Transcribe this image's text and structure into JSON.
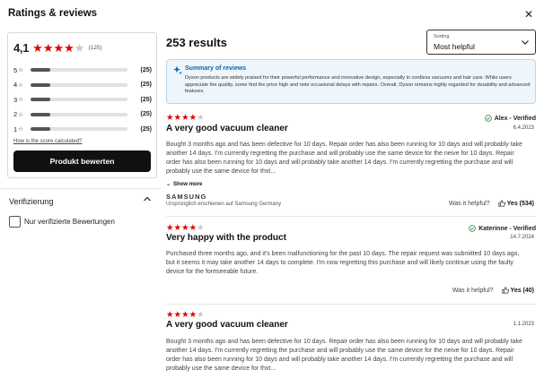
{
  "header": {
    "title": "Ratings & reviews",
    "close_icon": "close-icon"
  },
  "score": {
    "value": "4,1",
    "stars": 4,
    "count_label": "(125)",
    "distribution": [
      {
        "stars": "5",
        "count": "(25)",
        "fraction": 0.2
      },
      {
        "stars": "4",
        "count": "(25)",
        "fraction": 0.2
      },
      {
        "stars": "3",
        "count": "(25)",
        "fraction": 0.2
      },
      {
        "stars": "2",
        "count": "(25)",
        "fraction": 0.2
      },
      {
        "stars": "1",
        "count": "(25)",
        "fraction": 0.2
      }
    ],
    "how_link": "How is the score calculated?",
    "rate_button": "Produkt bewerten"
  },
  "filter": {
    "title": "Verifizierung",
    "option": "Nur verifizierte Bewertungen",
    "checked": false
  },
  "results": {
    "label": "253 results"
  },
  "sorting": {
    "label": "Sorting",
    "value": "Most helpful"
  },
  "summary": {
    "title": "Summary of reviews",
    "text": "Dyson products are widely praised for their powerful performance and innovative design, especially in cordless vacuums and hair care. While users appreciate the quality, some find the price high and note occasional delays with repairs. Overall, Dyson remains highly regarded for durability and advanced features."
  },
  "reviews": [
    {
      "stars": 4,
      "title": "A very good vacuum cleaner",
      "author": "Alex - Verified",
      "verified": true,
      "date": "6.4.2023",
      "body": "Bought 3 months ago and has been defective for 10 days. Repair order has also been running for 10 days and will probably take another 14 days. I'm currently regretting the purchase and will probably use the same device for the neive for 10 days. Repair order has also been running for 10 days and will probably take another 14 days. I'm currently regretting the purchase and will probably use the same device for thxt...",
      "show_more": "Show more",
      "brand": "SAMSUNG",
      "brand_note": "Ursprünglich erschienen auf Samsung Germany",
      "helpful_label": "Was it helpful?",
      "yes_label": "Yes (534)"
    },
    {
      "stars": 4,
      "title": "Very happy with the product",
      "author": "Katerinne - Verified",
      "verified": true,
      "date": "14.7.2024",
      "body": "Purchased three months ago, and it's been malfunctioning for the past 10 days. The repair request was submitted 10 days ago, but it seems it may take another 14 days to complete. I'm now regretting this purchase and will likely continue using the faulty device for the foreseeable future.",
      "helpful_label": "Was it helpful?",
      "yes_label": "Yes (40)"
    },
    {
      "stars": 4,
      "title": "A very good vacuum cleaner",
      "date": "1.1.2023",
      "body": "Bought 3 months ago and has been defective for 10 days. Repair order has also been running for 10 days and will probably take another 14 days. I'm currently regretting the purchase and will probably use the same device for the neive for 10 days. Repair order has also been running for 10 days and will probably take another 14 days. I'm currently regretting the purchase and will probably use the same device for thxt..."
    }
  ],
  "colors": {
    "star_on": "#df0000",
    "star_off": "#c8c8c8",
    "accent": "#0a66b0",
    "verified": "#1a8a3a"
  }
}
